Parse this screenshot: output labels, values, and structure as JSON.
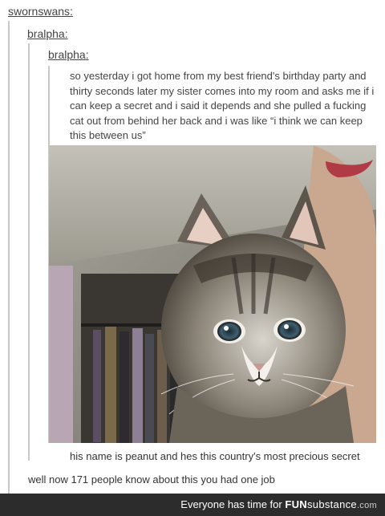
{
  "thread": {
    "user1": "swornswans:",
    "user2": "bralpha:",
    "user3": "bralpha:",
    "story": "so yesterday i got home from my best friend's birthday party and thirty seconds later my sister comes into my room and asks me if i can keep a secret and i said it depends and she pulled a fucking cat out from behind her back and i was like “i think we can keep this between us”",
    "caption": "his name is peanut and hes this country's most precious secret",
    "reply": "well now 171 people know about this you had one job"
  },
  "footer": {
    "tagline": "Everyone has time for",
    "brand_fun": "FUN",
    "brand_sub": "substance",
    "brand_com": ".com"
  },
  "colors": {
    "footer_bg": "#2c2c2c",
    "thread_bar": "#c8c8c8"
  },
  "photo": {
    "subject": "tabby-kitten-held-up-to-camera"
  }
}
